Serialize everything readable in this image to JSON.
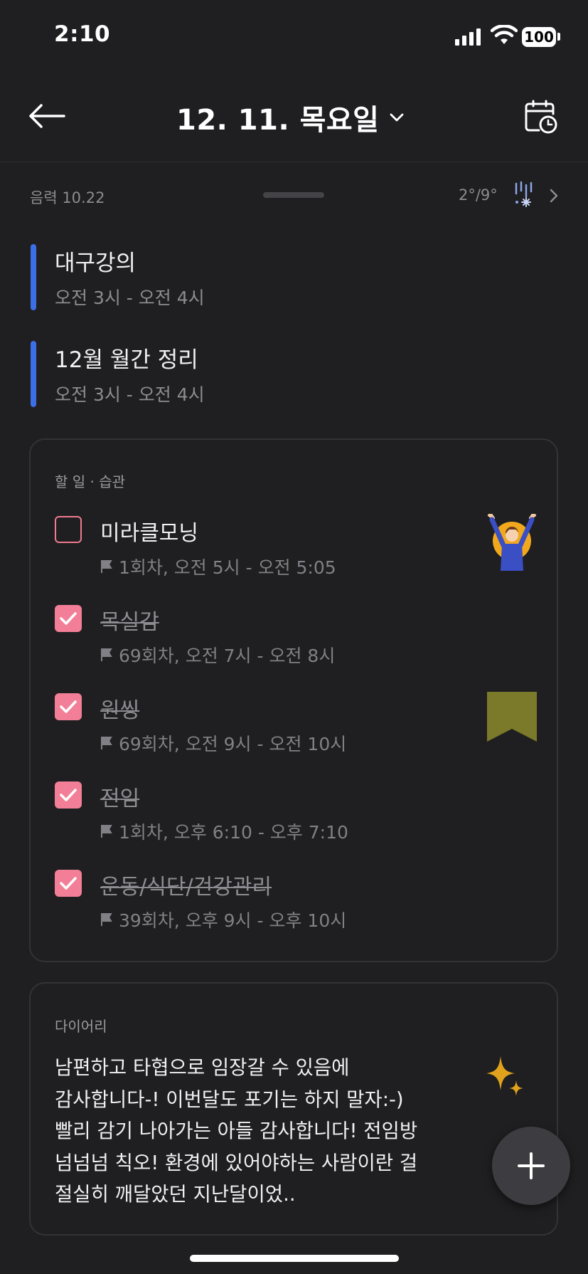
{
  "status_bar": {
    "time": "2:10",
    "battery": "100"
  },
  "header": {
    "title": "12. 11. 목요일"
  },
  "info_row": {
    "lunar": "음력 10.22",
    "weather": "2°/9°"
  },
  "events": [
    {
      "title": "대구강의",
      "time": "오전 3시 - 오전 4시",
      "color": "#3c6ee6"
    },
    {
      "title": "12월 월간 정리",
      "time": "오전 3시 - 오전 4시",
      "color": "#3c6ee6"
    }
  ],
  "todo": {
    "label": "할 일 · 습관",
    "items": [
      {
        "title": "미라클모닝",
        "meta": "1회차, 오전 5시 - 오전 5:05",
        "done": false
      },
      {
        "title": "목실감",
        "meta": "69회차, 오전 7시 - 오전 8시",
        "done": true
      },
      {
        "title": "원씽",
        "meta": "69회차, 오전 9시 - 오전 10시",
        "done": true
      },
      {
        "title": "전임",
        "meta": "1회차, 오후 6:10 - 오후 7:10",
        "done": true
      },
      {
        "title": "운동/식단/건강관리",
        "meta": "39회차, 오후 9시 - 오후 10시",
        "done": true
      }
    ],
    "check_color": "#f27f97",
    "bookmark_color": "#7b7a2a"
  },
  "diary": {
    "label": "다이어리",
    "lines": [
      "남편하고 타협으로 임장갈 수 있음에",
      "감사합니다-! 이번달도 포기는 하지 말자:-)",
      "빨리 감기 나아가는 아들 감사합니다! 전임방",
      "넘넘넘 칙오! 환경에 있어야하는 사람이란 걸",
      "절실히 깨달았던 지난달이었.."
    ]
  },
  "icons": {
    "back": "back-arrow-icon",
    "dropdown": "chevron-down-icon",
    "calendar": "calendar-clock-icon",
    "weather": "snow-icon",
    "fab": "plus-icon"
  }
}
